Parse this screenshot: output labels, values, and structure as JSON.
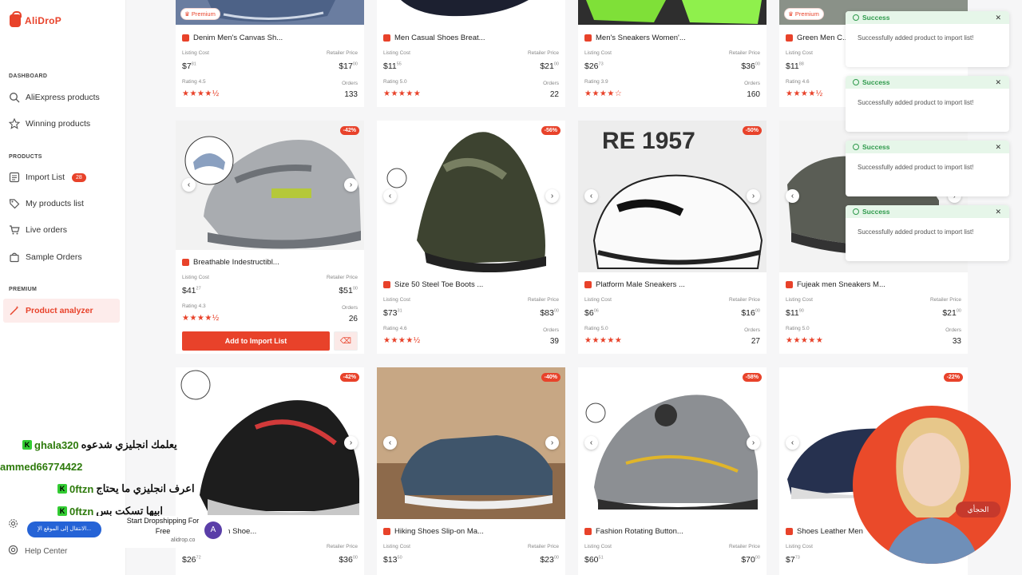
{
  "app": {
    "logo": "AliDroP"
  },
  "sidebar": {
    "section_dashboard": "DASHBOARD",
    "section_products": "PRODUCTS",
    "section_premium": "PREMIUM",
    "items": [
      {
        "label": "AliExpress products",
        "icon": "search-icon"
      },
      {
        "label": "Winning products",
        "icon": "star-icon"
      },
      {
        "label": "Import List",
        "icon": "list-icon",
        "badge": "28"
      },
      {
        "label": "My products list",
        "icon": "tag-icon"
      },
      {
        "label": "Live orders",
        "icon": "cart-icon"
      },
      {
        "label": "Sample Orders",
        "icon": "bag-icon"
      },
      {
        "label": "Product analyzer",
        "icon": "magic-wand-icon",
        "active": true
      }
    ],
    "help_center": "Help Center"
  },
  "labels": {
    "listing_cost": "Listing Cost",
    "retailer_price": "Retailer Price",
    "orders": "Orders",
    "premium": "Premium",
    "add_to_import": "Add to Import List"
  },
  "row1": [
    {
      "title": "Denim Men's Canvas Sh...",
      "cost": "$7",
      "cost_c": "81",
      "retail": "$17",
      "retail_c": "00",
      "rating": "Rating 4.5",
      "stars": "★★★★½",
      "orders": "133",
      "premium": true
    },
    {
      "title": "Men Casual Shoes Breat...",
      "cost": "$11",
      "cost_c": "55",
      "retail": "$21",
      "retail_c": "00",
      "rating": "Rating 5.0",
      "stars": "★★★★★",
      "orders": "22",
      "premium": false
    },
    {
      "title": "Men's Sneakers Women'...",
      "cost": "$26",
      "cost_c": "73",
      "retail": "$36",
      "retail_c": "00",
      "rating": "Rating 3.9",
      "stars": "★★★★☆",
      "orders": "160",
      "premium": false
    },
    {
      "title": "Green Men C...",
      "cost": "$11",
      "cost_c": "88",
      "retail": "$21",
      "retail_c": "00",
      "rating": "Rating 4.6",
      "stars": "★★★★½",
      "orders": "",
      "premium": true
    }
  ],
  "row2": [
    {
      "title": "Breathable Indestructibl...",
      "discount": "-42%",
      "cost": "$41",
      "cost_c": "27",
      "retail": "$51",
      "retail_c": "00",
      "rating": "Rating 4.3",
      "stars": "★★★★½",
      "orders": "26"
    },
    {
      "title": "Size 50 Steel Toe Boots ...",
      "discount": "-56%",
      "cost": "$73",
      "cost_c": "31",
      "retail": "$83",
      "retail_c": "00",
      "rating": "Rating 4.6",
      "stars": "★★★★½",
      "orders": "39"
    },
    {
      "title": "Platform Male Sneakers ...",
      "discount": "-50%",
      "cost": "$6",
      "cost_c": "06",
      "retail": "$16",
      "retail_c": "00",
      "rating": "Rating 5.0",
      "stars": "★★★★★",
      "orders": "27"
    },
    {
      "title": "Fujeak men Sneakers M...",
      "discount": "",
      "cost": "$11",
      "cost_c": "90",
      "retail": "$21",
      "retail_c": "00",
      "rating": "Rating 5.0",
      "stars": "★★★★★",
      "orders": "33"
    }
  ],
  "row3": [
    {
      "title": "...tible Men Shoe...",
      "discount": "-42%",
      "cost": "$26",
      "cost_c": "72",
      "retail": "$36",
      "retail_c": "00"
    },
    {
      "title": "Hiking Shoes Slip-on Ma...",
      "discount": "-40%",
      "cost": "$13",
      "cost_c": "50",
      "retail": "$23",
      "retail_c": "00"
    },
    {
      "title": "Fashion Rotating Button...",
      "discount": "-58%",
      "cost": "$60",
      "cost_c": "51",
      "retail": "$70",
      "retail_c": "00"
    },
    {
      "title": "Shoes Leather Men",
      "discount": "-22%",
      "cost": "$7",
      "cost_c": "73",
      "retail": "",
      "retail_c": ""
    }
  ],
  "toasts": [
    {
      "title": "Success",
      "text": "Successfully added product to import list!"
    },
    {
      "title": "Success",
      "text": "Successfully added product to import list!"
    },
    {
      "title": "Success",
      "text": "Successfully added product to import list!"
    },
    {
      "title": "Success",
      "text": "Successfully added product to import list!"
    }
  ],
  "overlay": {
    "chat": [
      {
        "name": "ghala320",
        "msg": "يعلمك انجليزي شدعوه"
      },
      {
        "name": "ammed66774422",
        "msg": ""
      },
      {
        "name": "0ftzn",
        "msg": "اعرف انجليزي ما يحتاج"
      },
      {
        "name": "0ftzn",
        "msg": "ابيها تسكت بس"
      }
    ],
    "promo_button": "الانتقال إلى الموقع الإ...",
    "promo_title": "Start Dropshipping For Free",
    "promo_url": "alidrop.co",
    "gift_label": "الحجأي"
  },
  "colors": {
    "brand": "#e8422a",
    "success": "#2f9a4c"
  }
}
